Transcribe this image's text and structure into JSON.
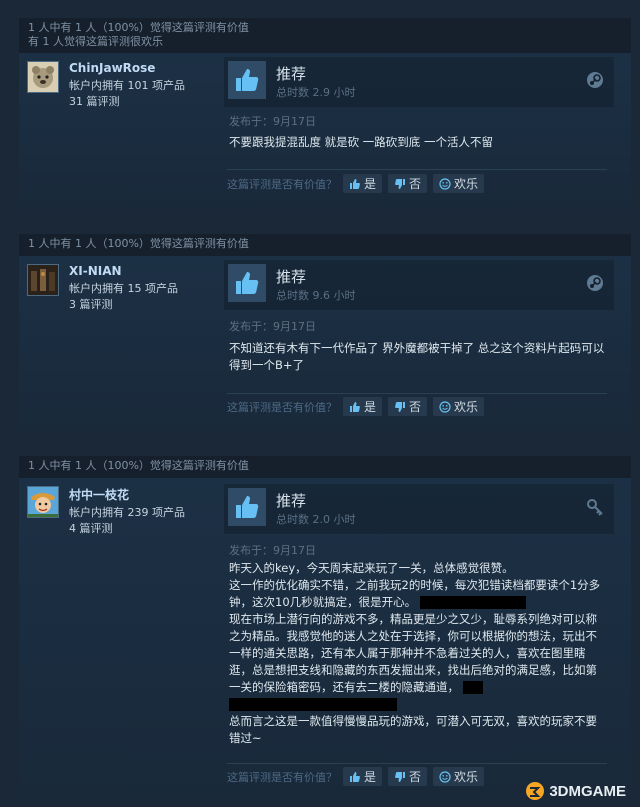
{
  "reviews": [
    {
      "helpful_line": "1 人中有 1 人（100%）觉得这篇评测有价值",
      "funny_line": "有 1 人觉得这篇评测很欢乐",
      "user": {
        "name": "ChinJawRose",
        "products": "帐户内拥有 101 项产品",
        "reviews": "31 篇评测"
      },
      "recommendation": "推荐",
      "hours": "总时数 2.9 小时",
      "posted": "发布于：9月17日",
      "content": [
        "不要跟我提混乱度 就是砍 一路砍到底 一个活人不留"
      ]
    },
    {
      "helpful_line": "1 人中有 1 人（100%）觉得这篇评测有价值",
      "user": {
        "name": "XI-NIAN",
        "products": "帐户内拥有 15 项产品",
        "reviews": "3 篇评测"
      },
      "recommendation": "推荐",
      "hours": "总时数 9.6 小时",
      "posted": "发布于：9月17日",
      "content": [
        "不知道还有木有下一代作品了 界外魔都被干掉了 总之这个资料片起码可以得到一个B+了"
      ]
    },
    {
      "helpful_line": "1 人中有 1 人（100%）觉得这篇评测有价值",
      "user": {
        "name": "村中一枝花",
        "products": "帐户内拥有 239 项产品",
        "reviews": "4 篇评测"
      },
      "recommendation": "推荐",
      "hours": "总时数 2.0 小时",
      "posted": "发布于：9月17日",
      "content": [
        "昨天入的key，今天周末起来玩了一关，总体感觉很赞。",
        "这一作的优化确实不错，之前我玩2的时候，每次犯错读档都要读个1分多钟，这次10几秒就搞定，很是开心。",
        "现在市场上潜行向的游戏不多，精品更是少之又少，耻辱系列绝对可以称之为精品。我感觉他的迷人之处在于选择，你可以根据你的想法，玩出不一样的通关思路，还有本人属于那种并不急着过关的人，喜欢在图里瞎逛，总是想把支线和隐藏的东西发掘出来，找出后绝对的满足感，比如第一关的保险箱密码，还有去二楼的隐藏通道，",
        "总而言之这是一款值得慢慢品玩的游戏，可潜入可无双，喜欢的玩家不要错过~"
      ]
    }
  ],
  "helpful_prompt": "这篇评测是否有价值？",
  "buttons": {
    "yes": "是",
    "no": "否",
    "funny": "欢乐"
  },
  "watermark": "3DMGAME"
}
